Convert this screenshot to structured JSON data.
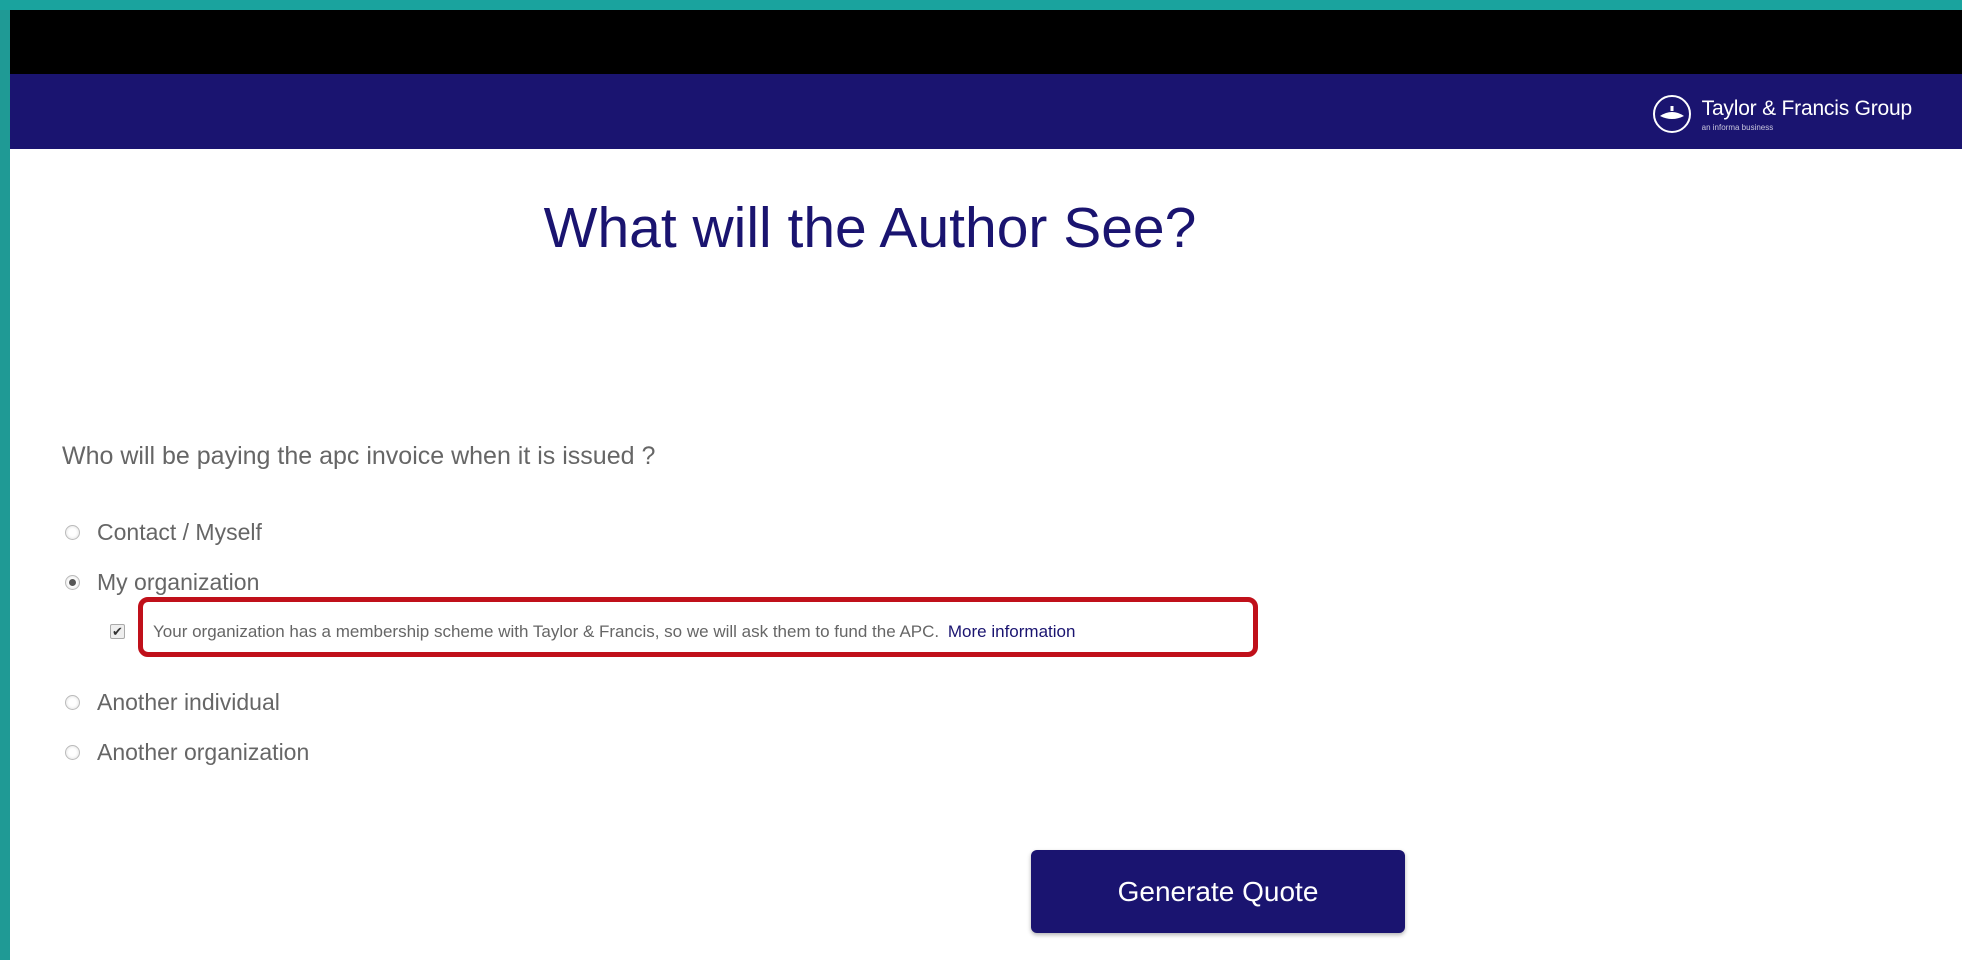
{
  "brand": {
    "name": "Taylor & Francis Group",
    "tagline": "an informa business"
  },
  "page": {
    "title": "What will the Author See?"
  },
  "form": {
    "question": "Who will be paying the apc invoice when it is issued ?",
    "options": [
      {
        "label": "Contact / Myself",
        "checked": false
      },
      {
        "label": "My organization",
        "checked": true
      },
      {
        "label": "Another individual",
        "checked": false
      },
      {
        "label": "Another organization",
        "checked": false
      }
    ],
    "membership_note": "Your organization has a membership scheme with Taylor & Francis, so we will ask them to fund the APC.",
    "more_info_link": "More information",
    "submit_label": "Generate Quote"
  },
  "colors": {
    "navy": "#1a1470",
    "highlight": "#c0101a",
    "teal_background": "#1f9a95"
  },
  "icons": {
    "brand_logo": "lamp-icon",
    "checkbox": "checkmark-icon"
  }
}
